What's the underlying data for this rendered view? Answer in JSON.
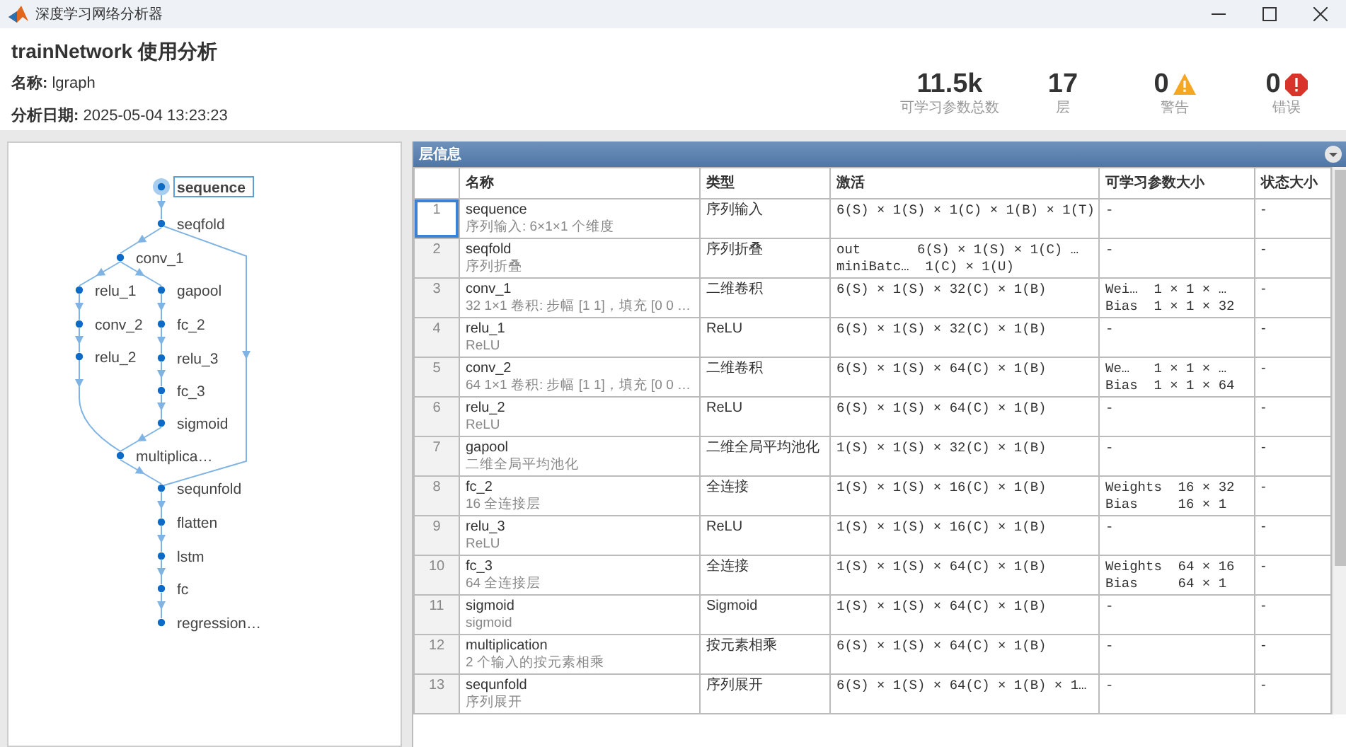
{
  "window": {
    "title": "深度学习网络分析器"
  },
  "header": {
    "title": "trainNetwork 使用分析",
    "name_label": "名称:",
    "name_value": "lgraph",
    "date_label": "分析日期:",
    "date_value": "2025-05-04 13:23:23"
  },
  "stats": [
    {
      "kind": "plain",
      "value": "11.5k",
      "label": "可学习参数总数"
    },
    {
      "kind": "plain",
      "value": "17",
      "label": "层"
    },
    {
      "kind": "warning",
      "value": "0",
      "label": "警告"
    },
    {
      "kind": "error",
      "value": "0",
      "label": "错误"
    }
  ],
  "graph": {
    "nodes": [
      {
        "label": "sequence",
        "selected": true
      },
      {
        "label": "seqfold",
        "selected": false
      },
      {
        "label": "conv_1",
        "selected": false
      },
      {
        "label": "relu_1",
        "selected": false
      },
      {
        "label": "gapool",
        "selected": false
      },
      {
        "label": "conv_2",
        "selected": false
      },
      {
        "label": "fc_2",
        "selected": false
      },
      {
        "label": "relu_2",
        "selected": false
      },
      {
        "label": "relu_3",
        "selected": false
      },
      {
        "label": "fc_3",
        "selected": false
      },
      {
        "label": "sigmoid",
        "selected": false
      },
      {
        "label": "multiplica…",
        "selected": false
      },
      {
        "label": "sequnfold",
        "selected": false
      },
      {
        "label": "flatten",
        "selected": false
      },
      {
        "label": "lstm",
        "selected": false
      },
      {
        "label": "fc",
        "selected": false
      },
      {
        "label": "regression…",
        "selected": false
      }
    ]
  },
  "table": {
    "title": "层信息",
    "columns": [
      "名称",
      "类型",
      "激活",
      "可学习参数大小",
      "状态大小"
    ],
    "rows": [
      {
        "index": "1",
        "name": "sequence",
        "description": "序列输入: 6×1×1 个维度",
        "type": "序列输入",
        "activations": [
          "6(S) × 1(S) × 1(C) × 1(B) × 1(T)"
        ],
        "learnables": [
          "-"
        ],
        "states": "-",
        "selected": true
      },
      {
        "index": "2",
        "name": "seqfold",
        "description": "序列折叠",
        "type": "序列折叠",
        "activations": [
          "out       6(S) × 1(S) × 1(C) …",
          "miniBatc…  1(C) × 1(U)"
        ],
        "learnables": [
          "-"
        ],
        "states": "-",
        "selected": false
      },
      {
        "index": "3",
        "name": "conv_1",
        "description": "32 1×1 卷积: 步幅 [1 1]，填充 [0 0 …",
        "type": "二维卷积",
        "activations": [
          "6(S) × 1(S) × 32(C) × 1(B)"
        ],
        "learnables": [
          "Wei…  1 × 1 × …",
          "Bias  1 × 1 × 32"
        ],
        "states": "-",
        "selected": false
      },
      {
        "index": "4",
        "name": "relu_1",
        "description": "ReLU",
        "type": "ReLU",
        "activations": [
          "6(S) × 1(S) × 32(C) × 1(B)"
        ],
        "learnables": [
          "-"
        ],
        "states": "-",
        "selected": false
      },
      {
        "index": "5",
        "name": "conv_2",
        "description": "64 1×1 卷积: 步幅 [1 1]，填充 [0 0 …",
        "type": "二维卷积",
        "activations": [
          "6(S) × 1(S) × 64(C) × 1(B)"
        ],
        "learnables": [
          "We…   1 × 1 × …",
          "Bias  1 × 1 × 64"
        ],
        "states": "-",
        "selected": false
      },
      {
        "index": "6",
        "name": "relu_2",
        "description": "ReLU",
        "type": "ReLU",
        "activations": [
          "6(S) × 1(S) × 64(C) × 1(B)"
        ],
        "learnables": [
          "-"
        ],
        "states": "-",
        "selected": false
      },
      {
        "index": "7",
        "name": "gapool",
        "description": "二维全局平均池化",
        "type": "二维全局平均池化",
        "activations": [
          "1(S) × 1(S) × 32(C) × 1(B)"
        ],
        "learnables": [
          "-"
        ],
        "states": "-",
        "selected": false
      },
      {
        "index": "8",
        "name": "fc_2",
        "description": "16 全连接层",
        "type": "全连接",
        "activations": [
          "1(S) × 1(S) × 16(C) × 1(B)"
        ],
        "learnables": [
          "Weights  16 × 32",
          "Bias     16 × 1"
        ],
        "states": "-",
        "selected": false
      },
      {
        "index": "9",
        "name": "relu_3",
        "description": "ReLU",
        "type": "ReLU",
        "activations": [
          "1(S) × 1(S) × 16(C) × 1(B)"
        ],
        "learnables": [
          "-"
        ],
        "states": "-",
        "selected": false
      },
      {
        "index": "10",
        "name": "fc_3",
        "description": "64 全连接层",
        "type": "全连接",
        "activations": [
          "1(S) × 1(S) × 64(C) × 1(B)"
        ],
        "learnables": [
          "Weights  64 × 16",
          "Bias     64 × 1"
        ],
        "states": "-",
        "selected": false
      },
      {
        "index": "11",
        "name": "sigmoid",
        "description": "sigmoid",
        "type": "Sigmoid",
        "activations": [
          "1(S) × 1(S) × 64(C) × 1(B)"
        ],
        "learnables": [
          "-"
        ],
        "states": "-",
        "selected": false
      },
      {
        "index": "12",
        "name": "multiplication",
        "description": "2 个输入的按元素相乘",
        "type": "按元素相乘",
        "activations": [
          "6(S) × 1(S) × 64(C) × 1(B)"
        ],
        "learnables": [
          "-"
        ],
        "states": "-",
        "selected": false
      },
      {
        "index": "13",
        "name": "sequnfold",
        "description": "序列展开",
        "type": "序列展开",
        "activations": [
          "6(S) × 1(S) × 64(C) × 1(B) × 1…"
        ],
        "learnables": [
          "-"
        ],
        "states": "-",
        "selected": false
      }
    ]
  }
}
